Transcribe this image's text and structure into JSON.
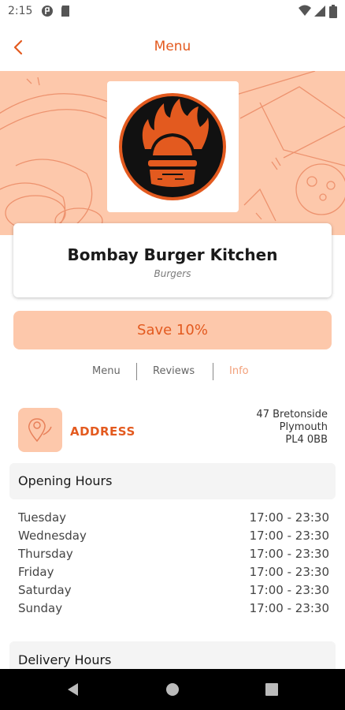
{
  "status": {
    "time": "2:15"
  },
  "header": {
    "title": "Menu"
  },
  "restaurant": {
    "name": "Bombay Burger Kitchen",
    "category": "Burgers"
  },
  "offer": {
    "label": "Save 10%"
  },
  "tabs": [
    {
      "label": "Menu"
    },
    {
      "label": "Reviews"
    },
    {
      "label": "Info"
    }
  ],
  "address": {
    "label": "ADDRESS",
    "line1": "47 Bretonside",
    "line2": "Plymouth",
    "line3": "PL4 0BB"
  },
  "opening_hours": {
    "title": "Opening Hours",
    "rows": [
      {
        "day": "Tuesday",
        "time": "17:00  -  23:30"
      },
      {
        "day": "Wednesday",
        "time": "17:00  -  23:30"
      },
      {
        "day": "Thursday",
        "time": "17:00  -  23:30"
      },
      {
        "day": "Friday",
        "time": "17:00  -  23:30"
      },
      {
        "day": "Saturday",
        "time": "17:00  -  23:30"
      },
      {
        "day": "Sunday",
        "time": "17:00  -  23:30"
      }
    ]
  },
  "delivery_hours": {
    "title": "Delivery Hours"
  },
  "colors": {
    "accent": "#e35a1f",
    "accent_light": "#fdc8ab",
    "logo_bg": "#111111"
  }
}
